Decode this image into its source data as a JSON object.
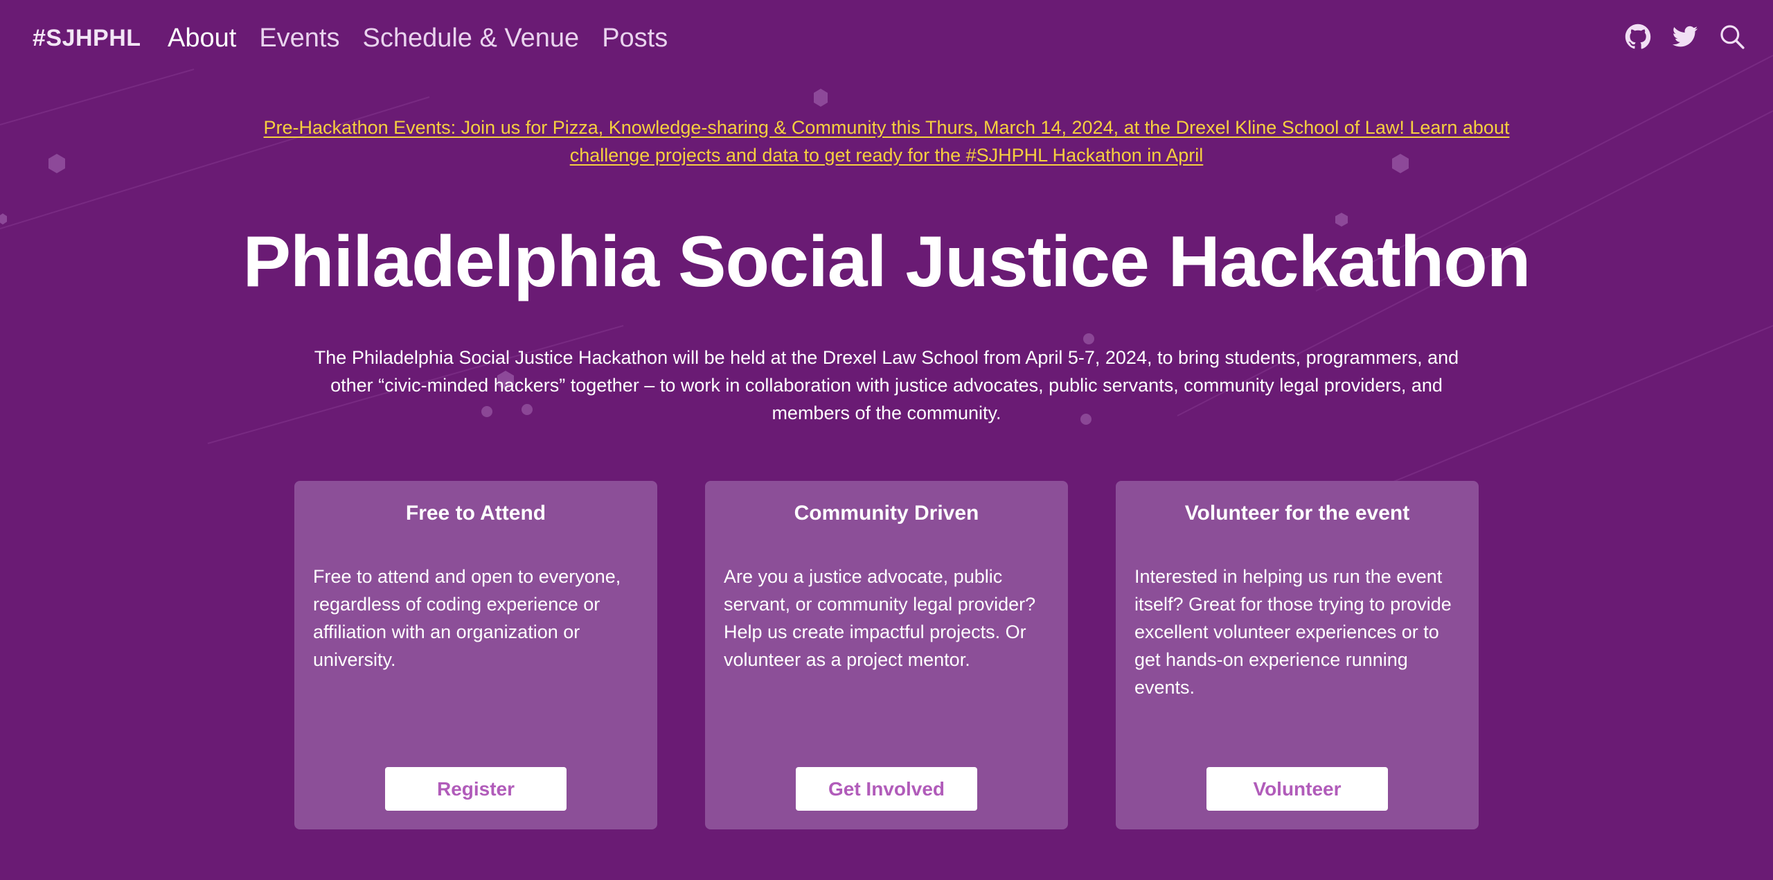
{
  "nav": {
    "brand": "#SJHPHL",
    "links": [
      {
        "label": "About",
        "active": true
      },
      {
        "label": "Events",
        "active": false
      },
      {
        "label": "Schedule & Venue",
        "active": false
      },
      {
        "label": "Posts",
        "active": false
      }
    ],
    "icons": [
      "github-icon",
      "twitter-icon",
      "search-icon"
    ]
  },
  "announcement": {
    "text": "Pre-Hackathon Events: Join us for Pizza, Knowledge-sharing & Community this Thurs, March 14, 2024, at the Drexel Kline School of Law! Learn about challenge projects and data to get ready for the #SJHPHL Hackathon in April"
  },
  "hero": {
    "title": "Philadelphia Social Justice Hackathon",
    "description": "The Philadelphia Social Justice Hackathon will be held at the Drexel Law School from April 5-7, 2024, to bring students, programmers, and other “civic-minded hackers” together – to work in collaboration with justice advocates, public servants, community legal providers, and members of the community."
  },
  "cards": [
    {
      "title": "Free to Attend",
      "body": "Free to attend and open to everyone, regardless of coding experience or affiliation with an organization or university.",
      "button": "Register"
    },
    {
      "title": "Community Driven",
      "body": "Are you a justice advocate, public servant, or community legal provider? Help us create impactful projects. Or volunteer as a project mentor.",
      "button": "Get Involved"
    },
    {
      "title": "Volunteer for the event",
      "body": "Interested in helping us run the event itself? Great for those trying to provide excellent volunteer experiences or to get hands-on experience running events.",
      "button": "Volunteer"
    }
  ],
  "colors": {
    "background": "#6a1b74",
    "card": "#8c4f98",
    "announcement": "#f6cf3f",
    "button_text": "#b15cba"
  }
}
